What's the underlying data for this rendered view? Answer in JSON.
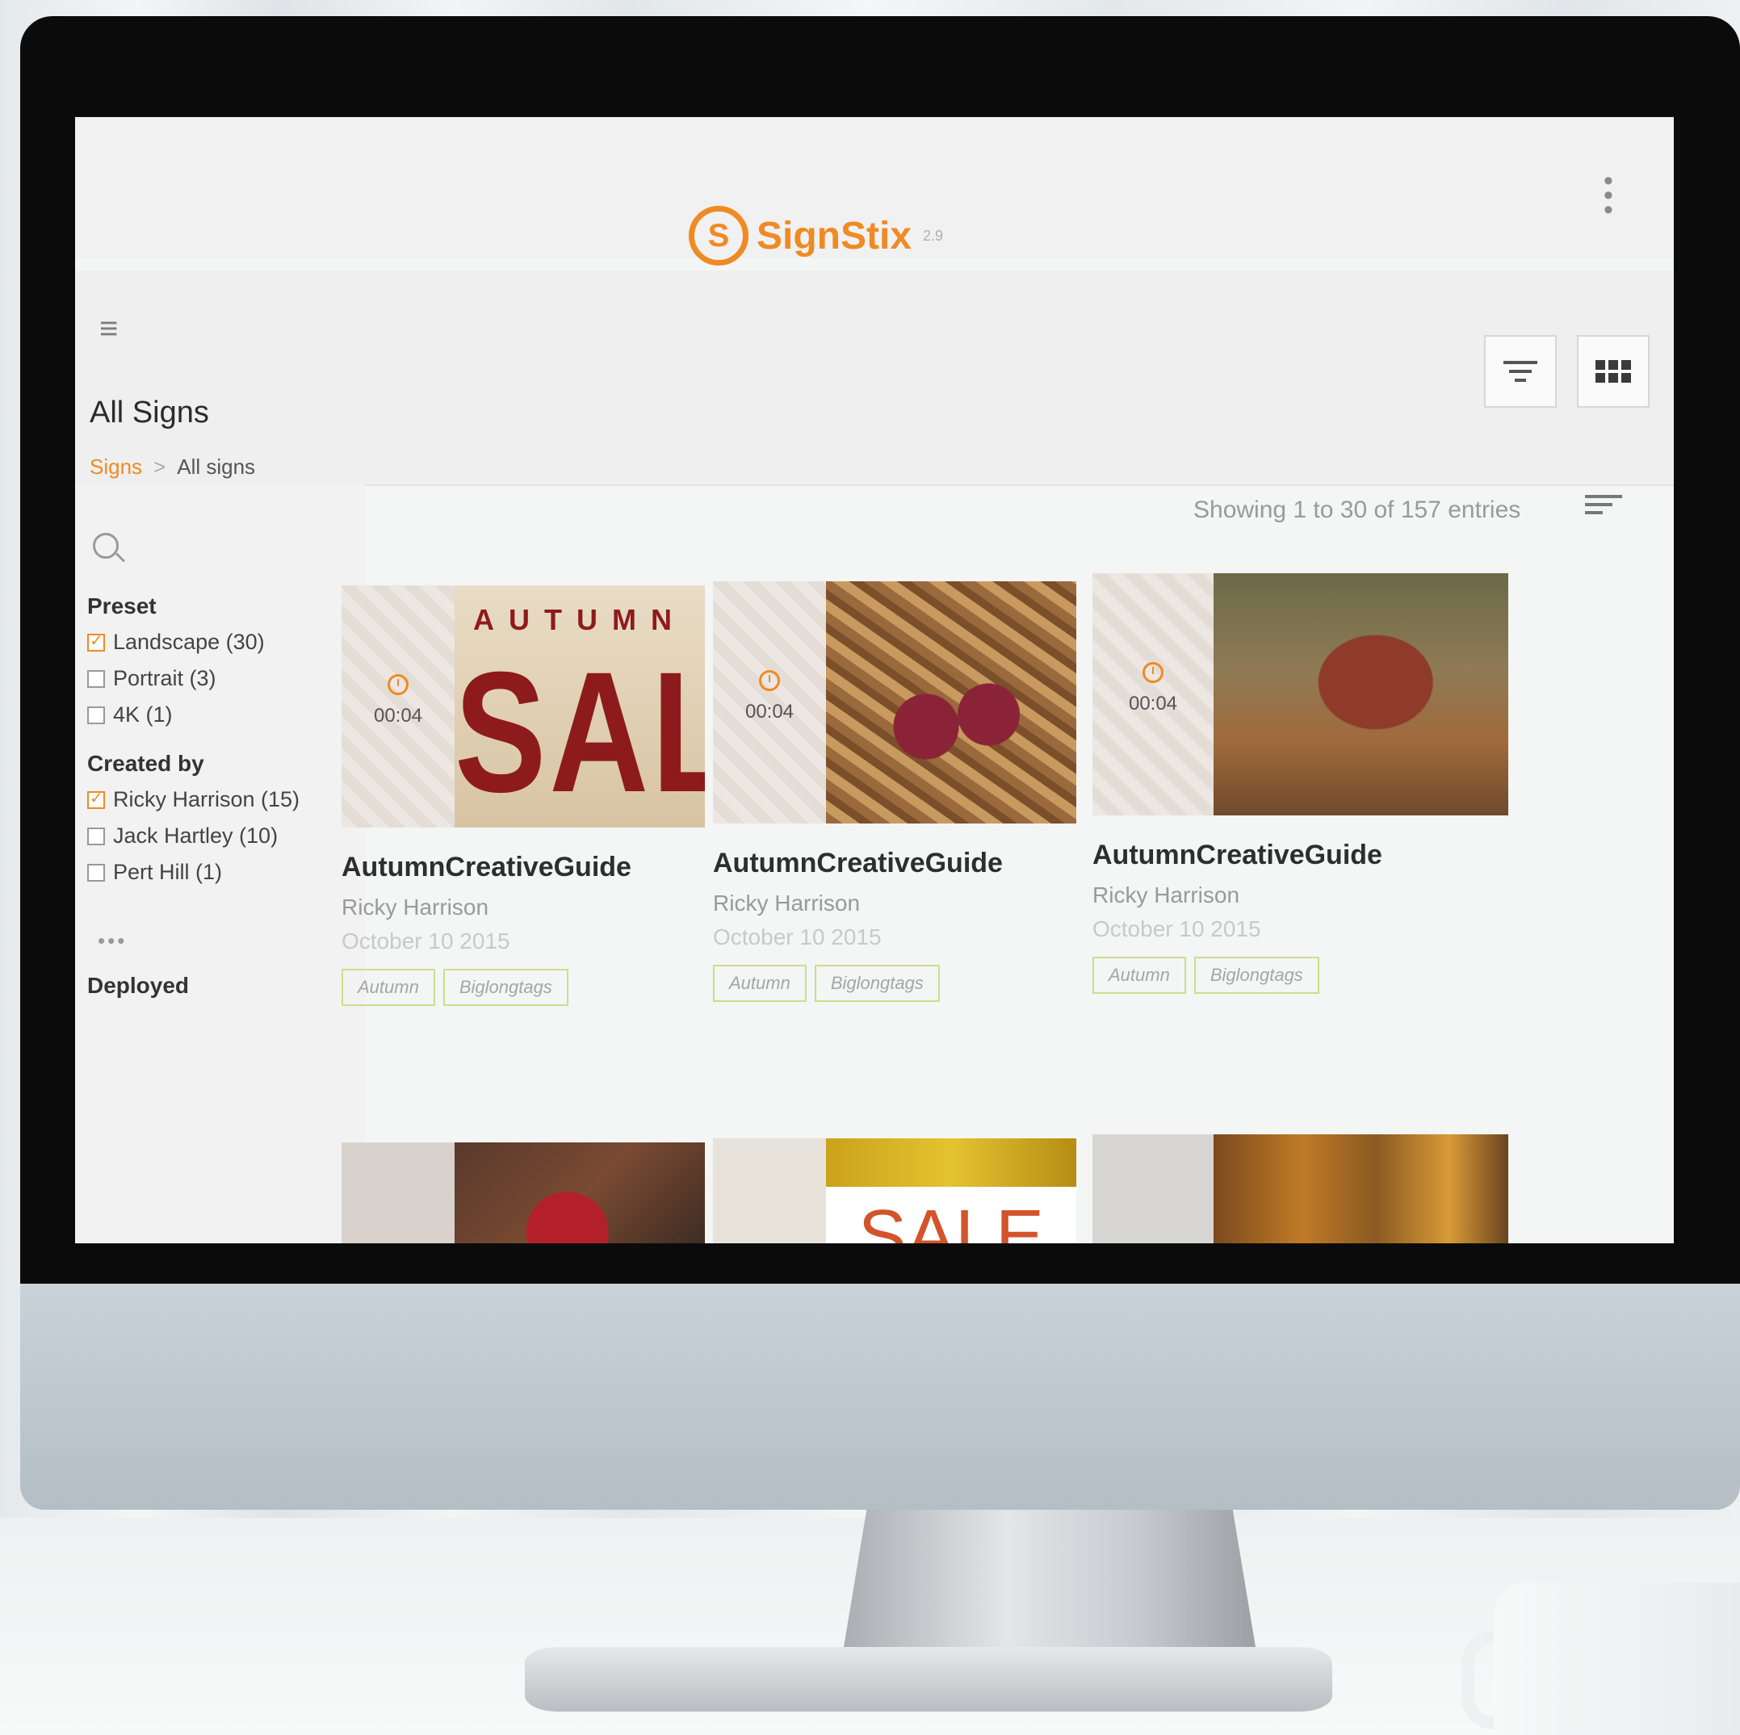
{
  "app": {
    "brand": "SignStix",
    "version": "2.9",
    "accent_color": "#f08a24"
  },
  "header": {
    "menu_icon": "hamburger-icon",
    "kebab_icon": "more-vert-icon",
    "filter_button_icon": "filter-icon",
    "grid_button_icon": "grid-view-icon"
  },
  "page": {
    "title": "All Signs",
    "breadcrumb": {
      "link": "Signs",
      "separator": ">",
      "current": "All signs"
    },
    "entries_text": "Showing 1 to 30 of 157 entries"
  },
  "sidebar": {
    "sections": [
      {
        "title": "Preset",
        "options": [
          {
            "label": "Landscape (30)",
            "checked": true
          },
          {
            "label": "Portrait (3)",
            "checked": false
          },
          {
            "label": "4K (1)",
            "checked": false
          }
        ]
      },
      {
        "title": "Created by",
        "options": [
          {
            "label": "Ricky Harrison (15)",
            "checked": true
          },
          {
            "label": "Jack Hartley (10)",
            "checked": false
          },
          {
            "label": "Pert Hill (1)",
            "checked": false
          }
        ]
      }
    ],
    "more": "•••",
    "deployed_title": "Deployed"
  },
  "cards": [
    {
      "title": "AutumnCreativeGuide",
      "author": "Ricky Harrison",
      "date": "October 10 2015",
      "duration": "00:04",
      "tags": [
        "Autumn",
        "Biglongtags"
      ],
      "thumb_text_top": "AUTUMN",
      "thumb_text_main": "SALE"
    },
    {
      "title": "AutumnCreativeGuide",
      "author": "Ricky Harrison",
      "date": "October 10 2015",
      "duration": "00:04",
      "tags": [
        "Autumn",
        "Biglongtags"
      ]
    },
    {
      "title": "AutumnCreativeGuide",
      "author": "Ricky Harrison",
      "date": "October 10 2015",
      "duration": "00:04",
      "tags": [
        "Autumn",
        "Biglongtags"
      ]
    }
  ],
  "row2": {
    "sale_text": "SALE"
  }
}
